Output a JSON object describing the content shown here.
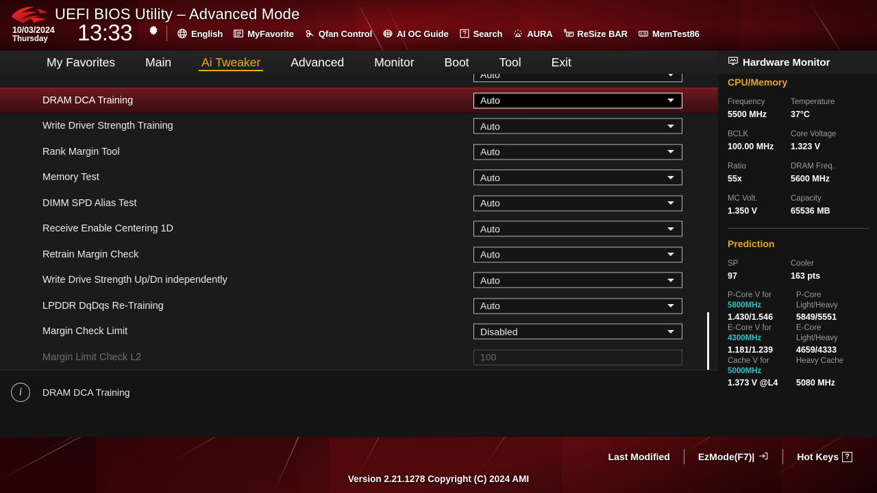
{
  "header": {
    "title": "UEFI BIOS Utility – Advanced Mode",
    "logo": "rog-logo",
    "date": "10/03/2024",
    "weekday": "Thursday",
    "time": "13:33",
    "gear_icon": "gear-icon",
    "tools": [
      {
        "label": "English",
        "icon": "globe-icon"
      },
      {
        "label": "MyFavorite",
        "icon": "star-list-icon"
      },
      {
        "label": "Qfan Control",
        "icon": "fan-icon"
      },
      {
        "label": "AI OC Guide",
        "icon": "brain-icon"
      },
      {
        "label": "Search",
        "icon": "question-box-icon"
      },
      {
        "label": "AURA",
        "icon": "aura-light-icon"
      },
      {
        "label": "ReSize BAR",
        "icon": "resize-bar-icon"
      },
      {
        "label": "MemTest86",
        "icon": "memtest-icon"
      }
    ]
  },
  "menu": {
    "items": [
      {
        "label": "My Favorites",
        "active": false
      },
      {
        "label": "Main",
        "active": false
      },
      {
        "label": "Ai Tweaker",
        "active": true
      },
      {
        "label": "Advanced",
        "active": false
      },
      {
        "label": "Monitor",
        "active": false
      },
      {
        "label": "Boot",
        "active": false
      },
      {
        "label": "Tool",
        "active": false
      },
      {
        "label": "Exit",
        "active": false
      }
    ],
    "active_color": "#f0a90b"
  },
  "settings": {
    "rows": [
      {
        "label": "",
        "value": "Auto",
        "type": "dropdown",
        "state": "clipped"
      },
      {
        "label": "DRAM DCA Training",
        "value": "Auto",
        "type": "dropdown",
        "state": "selected"
      },
      {
        "label": "Write Driver Strength Training",
        "value": "Auto",
        "type": "dropdown",
        "state": "normal"
      },
      {
        "label": "Rank Margin Tool",
        "value": "Auto",
        "type": "dropdown",
        "state": "normal"
      },
      {
        "label": "Memory Test",
        "value": "Auto",
        "type": "dropdown",
        "state": "normal"
      },
      {
        "label": "DIMM SPD Alias Test",
        "value": "Auto",
        "type": "dropdown",
        "state": "normal"
      },
      {
        "label": "Receive Enable Centering 1D",
        "value": "Auto",
        "type": "dropdown",
        "state": "normal"
      },
      {
        "label": "Retrain Margin Check",
        "value": "Auto",
        "type": "dropdown",
        "state": "normal"
      },
      {
        "label": "Write Drive Strength Up/Dn independently",
        "value": "Auto",
        "type": "dropdown",
        "state": "normal"
      },
      {
        "label": "LPDDR DqDqs Re-Training",
        "value": "Auto",
        "type": "dropdown",
        "state": "normal"
      },
      {
        "label": "Margin Check Limit",
        "value": "Disabled",
        "type": "dropdown",
        "state": "normal"
      },
      {
        "label": "Margin Limit Check L2",
        "value": "100",
        "type": "text",
        "state": "disabled"
      }
    ],
    "highlight_color": "#6d1a1e"
  },
  "help": {
    "icon": "info-icon",
    "text": "DRAM DCA Training"
  },
  "hardware_monitor": {
    "title": "Hardware Monitor",
    "icon": "monitor-icon",
    "section_cpu": "CPU/Memory",
    "cpu_memory": [
      {
        "key": "Frequency",
        "value": "5500 MHz"
      },
      {
        "key": "Temperature",
        "value": "37°C"
      },
      {
        "key": "BCLK",
        "value": "100.00 MHz"
      },
      {
        "key": "Core Voltage",
        "value": "1.323 V"
      },
      {
        "key": "Ratio",
        "value": "55x"
      },
      {
        "key": "DRAM Freq.",
        "value": "5600 MHz"
      },
      {
        "key": "MC Volt.",
        "value": "1.350 V"
      },
      {
        "key": "Capacity",
        "value": "65536 MB"
      }
    ],
    "section_prediction": "Prediction",
    "prediction": [
      {
        "key": "SP",
        "value": "97"
      },
      {
        "key": "Cooler",
        "value": "163 pts"
      }
    ],
    "prediction_detail": [
      {
        "key_pre": "P-Core V for",
        "key_hz": "5800MHz",
        "key_post": "",
        "value": "1.430/1.546"
      },
      {
        "key_pre": "P-Core",
        "key_hz": "",
        "key_post": "Light/Heavy",
        "value": "5849/5551"
      },
      {
        "key_pre": "E-Core V for",
        "key_hz": "4300MHz",
        "key_post": "",
        "value": "1.181/1.239"
      },
      {
        "key_pre": "E-Core",
        "key_hz": "",
        "key_post": "Light/Heavy",
        "value": "4659/4333"
      },
      {
        "key_pre": "Cache V for",
        "key_hz": "5000MHz",
        "key_post": "",
        "value": "1.373 V @L4"
      },
      {
        "key_pre": "Heavy Cache",
        "key_hz": "",
        "key_post": "",
        "value": "5080 MHz"
      }
    ],
    "accent_color": "#e8a81c",
    "hz_color": "#1ec8c8"
  },
  "footer": {
    "last_modified": "Last Modified",
    "ez_mode": "EzMode(F7)|",
    "ez_mode_icon": "arrow-into-box-icon",
    "hot_keys": "Hot Keys",
    "hot_keys_badge": "?",
    "version": "Version 2.21.1278 Copyright (C) 2024 AMI"
  }
}
